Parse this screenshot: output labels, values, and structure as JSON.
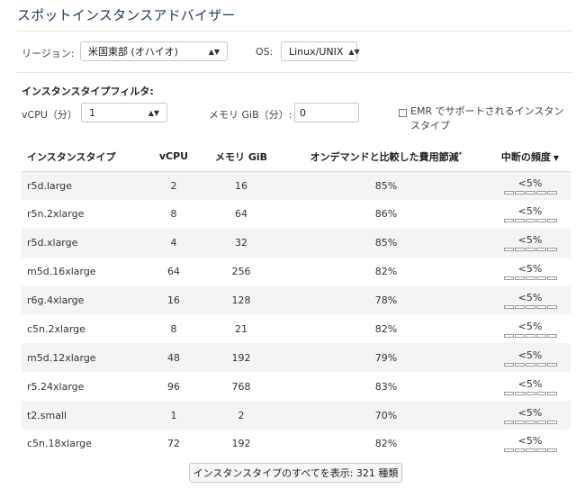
{
  "title": "スポットインスタンスアドバイザー",
  "filters": {
    "region_label": "リージョン:",
    "region_value": "米国東部 (オハイオ)",
    "os_label": "OS:",
    "os_value": "Linux/UNIX",
    "instance_filter_title": "インスタンスタイプフィルタ:",
    "vcpu_label": "vCPU（分）",
    "vcpu_value": "1",
    "memory_label": "メモリ GiB（分）:",
    "memory_value": "0",
    "emr_label": "EMR でサポートされるインスタンスタイプ",
    "emr_checked": false
  },
  "table": {
    "headers": {
      "instance_type": "インスタンスタイプ",
      "vcpu": "vCPU",
      "memory": "メモリ GiB",
      "savings": "オンデマンドと比較した費用節減",
      "savings_mark": "*",
      "interruption": "中断の頻度"
    },
    "rows": [
      {
        "type": "r5d.large",
        "vcpu": "2",
        "memory": "16",
        "savings": "85%",
        "freq": "<5%"
      },
      {
        "type": "r5n.2xlarge",
        "vcpu": "8",
        "memory": "64",
        "savings": "86%",
        "freq": "<5%"
      },
      {
        "type": "r5d.xlarge",
        "vcpu": "4",
        "memory": "32",
        "savings": "85%",
        "freq": "<5%"
      },
      {
        "type": "m5d.16xlarge",
        "vcpu": "64",
        "memory": "256",
        "savings": "82%",
        "freq": "<5%"
      },
      {
        "type": "r6g.4xlarge",
        "vcpu": "16",
        "memory": "128",
        "savings": "78%",
        "freq": "<5%"
      },
      {
        "type": "c5n.2xlarge",
        "vcpu": "8",
        "memory": "21",
        "savings": "82%",
        "freq": "<5%"
      },
      {
        "type": "m5d.12xlarge",
        "vcpu": "48",
        "memory": "192",
        "savings": "79%",
        "freq": "<5%"
      },
      {
        "type": "r5.24xlarge",
        "vcpu": "96",
        "memory": "768",
        "savings": "83%",
        "freq": "<5%"
      },
      {
        "type": "t2.small",
        "vcpu": "1",
        "memory": "2",
        "savings": "70%",
        "freq": "<5%"
      },
      {
        "type": "c5n.18xlarge",
        "vcpu": "72",
        "memory": "192",
        "savings": "82%",
        "freq": "<5%"
      }
    ]
  },
  "show_all_button": "インスタンスタイプのすべてを表示: 321 種類"
}
